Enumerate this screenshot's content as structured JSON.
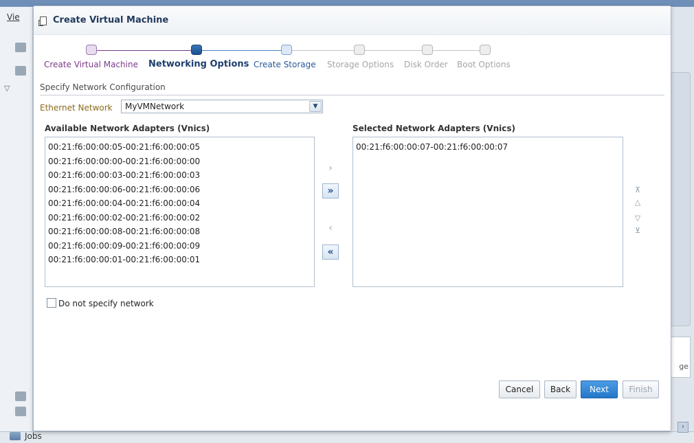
{
  "background": {
    "menu_label": "Vie",
    "jobs_label": "Jobs",
    "side_panel_label": "ge"
  },
  "dialog": {
    "title": "Create Virtual Machine",
    "icon": "virtual-machine-icon"
  },
  "train": {
    "steps": [
      {
        "label": "Create Virtual Machine",
        "state": "visited"
      },
      {
        "label": "Networking Options",
        "state": "current"
      },
      {
        "label": "Create Storage",
        "state": "next"
      },
      {
        "label": "Storage Options",
        "state": "disabled"
      },
      {
        "label": "Disk Order",
        "state": "disabled"
      },
      {
        "label": "Boot Options",
        "state": "disabled"
      }
    ]
  },
  "section": {
    "title": "Specify Network Configuration"
  },
  "ethernet": {
    "label": "Ethernet Network",
    "value": "MyVMNetwork"
  },
  "available": {
    "header": "Available Network Adapters (Vnics)",
    "items": [
      "00:21:f6:00:00:05-00:21:f6:00:00:05",
      "00:21:f6:00:00:00-00:21:f6:00:00:00",
      "00:21:f6:00:00:03-00:21:f6:00:00:03",
      "00:21:f6:00:00:06-00:21:f6:00:00:06",
      "00:21:f6:00:00:04-00:21:f6:00:00:04",
      "00:21:f6:00:00:02-00:21:f6:00:00:02",
      "00:21:f6:00:00:08-00:21:f6:00:00:08",
      "00:21:f6:00:00:09-00:21:f6:00:00:09",
      "00:21:f6:00:00:01-00:21:f6:00:00:01"
    ]
  },
  "selected": {
    "header": "Selected Network Adapters (Vnics)",
    "items": [
      "00:21:f6:00:00:07-00:21:f6:00:00:07"
    ]
  },
  "shuttle": {
    "move": "›",
    "move_all": "»",
    "remove": "‹",
    "remove_all": "«"
  },
  "reorder": {
    "top": "⊼",
    "up": "△",
    "down": "▽",
    "bottom": "⊻"
  },
  "checkbox": {
    "label": "Do not specify network",
    "checked": false
  },
  "buttons": {
    "cancel": "Cancel",
    "back": "Back",
    "next": "Next",
    "finish": "Finish"
  },
  "colors": {
    "accent": "#2377c8",
    "visited": "#7a3a8a",
    "current": "#1f3f6e"
  }
}
